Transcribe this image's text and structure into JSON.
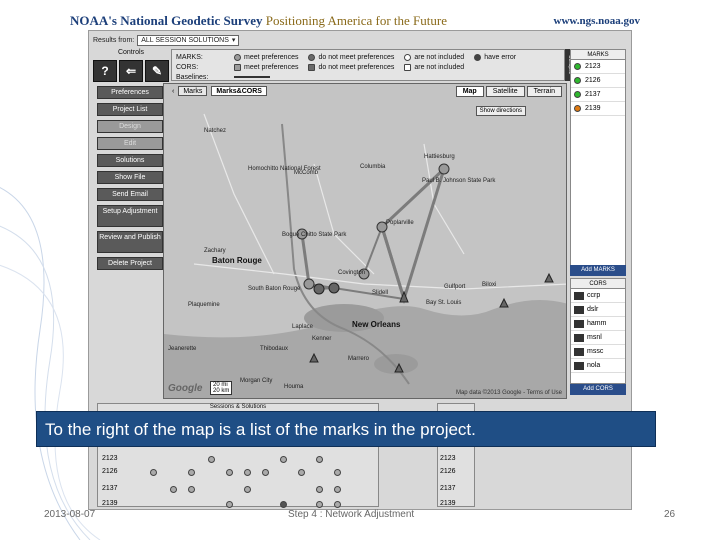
{
  "header": {
    "brand_blue": "NOAA's National Geodetic Survey",
    "brand_gold": "Positioning America for the Future",
    "url": "www.ngs.noaa.gov"
  },
  "toolbar": {
    "results_label": "Results from:",
    "results_value": "ALL SESSION SOLUTIONS",
    "controls_label": "Controls",
    "icons": [
      "question-icon",
      "back-arrow-icon",
      "tool-icon"
    ]
  },
  "legend": {
    "marks_label": "MARKS:",
    "cors_label": "CORS:",
    "baselines_label": "Baselines:",
    "meet": "meet preferences",
    "not_meet": "do not meet preferences",
    "not_included": "are not included",
    "error": "have error",
    "side_tab": "Collapse"
  },
  "menu": {
    "items": [
      {
        "label": "Preferences",
        "tall": false,
        "light": false
      },
      {
        "label": "Project List",
        "tall": false,
        "light": false
      },
      {
        "label": "Design",
        "tall": false,
        "light": true
      },
      {
        "label": "Edit",
        "tall": false,
        "light": true
      },
      {
        "label": "Solutions",
        "tall": false,
        "light": false
      },
      {
        "label": "Show File",
        "tall": false,
        "light": false
      },
      {
        "label": "Send Email",
        "tall": false,
        "light": false
      },
      {
        "label": "Setup Adjustment",
        "tall": true,
        "light": false
      },
      {
        "label": "Review and Publish",
        "tall": true,
        "light": false
      },
      {
        "label": "Delete Project",
        "tall": false,
        "light": false
      }
    ]
  },
  "map": {
    "view_buttons": [
      "Marks",
      "Marks&CORS"
    ],
    "type_buttons": [
      "Map",
      "Satellite",
      "Terrain"
    ],
    "show_directions": "Show directions",
    "google": "Google",
    "scale_mi": "20 mi",
    "scale_km": "20 km",
    "map_data": "Map data ©2013 Google - Terms of Use",
    "places": [
      {
        "name": "Natchez",
        "big": false
      },
      {
        "name": "Columbia",
        "big": false
      },
      {
        "name": "Hattiesburg",
        "big": false
      },
      {
        "name": "Homochitto National Forest",
        "big": false
      },
      {
        "name": "McComb",
        "big": false
      },
      {
        "name": "Paul B. Johnson State Park",
        "big": false
      },
      {
        "name": "Poplarville",
        "big": false
      },
      {
        "name": "Zachary",
        "big": false
      },
      {
        "name": "Baton Rouge",
        "big": true
      },
      {
        "name": "Covington",
        "big": false
      },
      {
        "name": "Slidell",
        "big": false
      },
      {
        "name": "Gulfport",
        "big": false
      },
      {
        "name": "Biloxi",
        "big": false
      },
      {
        "name": "Bay St. Louis",
        "big": false
      },
      {
        "name": "Plaquemine",
        "big": false
      },
      {
        "name": "South Baton Rouge",
        "big": false
      },
      {
        "name": "Laplace",
        "big": false
      },
      {
        "name": "Kenner",
        "big": false
      },
      {
        "name": "New Orleans",
        "big": true
      },
      {
        "name": "Marrero",
        "big": false
      },
      {
        "name": "Thibodaux",
        "big": false
      },
      {
        "name": "Morgan City",
        "big": false
      },
      {
        "name": "Houma",
        "big": false
      },
      {
        "name": "Bogue Chitto State Park",
        "big": false
      },
      {
        "name": "Jeanerette",
        "big": false
      }
    ]
  },
  "marks_panel": {
    "title": "MARKS",
    "items": [
      {
        "id": "2123",
        "color": "#2eb82e"
      },
      {
        "id": "2126",
        "color": "#2eb82e"
      },
      {
        "id": "2137",
        "color": "#2eb82e"
      },
      {
        "id": "2139",
        "color": "#e07a10"
      }
    ],
    "add_label": "Add MARKS"
  },
  "cors_panel": {
    "title": "CORS",
    "items": [
      "ccrp",
      "dslr",
      "hamm",
      "msnl",
      "mssc",
      "nola"
    ],
    "add_label": "Add CORS"
  },
  "sessions": {
    "title": "Sessions & Solutions",
    "rows": [
      "2123",
      "2126",
      "2137",
      "2139"
    ],
    "right_rows": [
      "2123",
      "2126",
      "2137",
      "2139"
    ]
  },
  "caption": "To the right of the map is a list of the marks in the project.",
  "footer": {
    "date": "2013-08-07",
    "step": "Step 4 : Network Adjustment",
    "page": "26"
  }
}
